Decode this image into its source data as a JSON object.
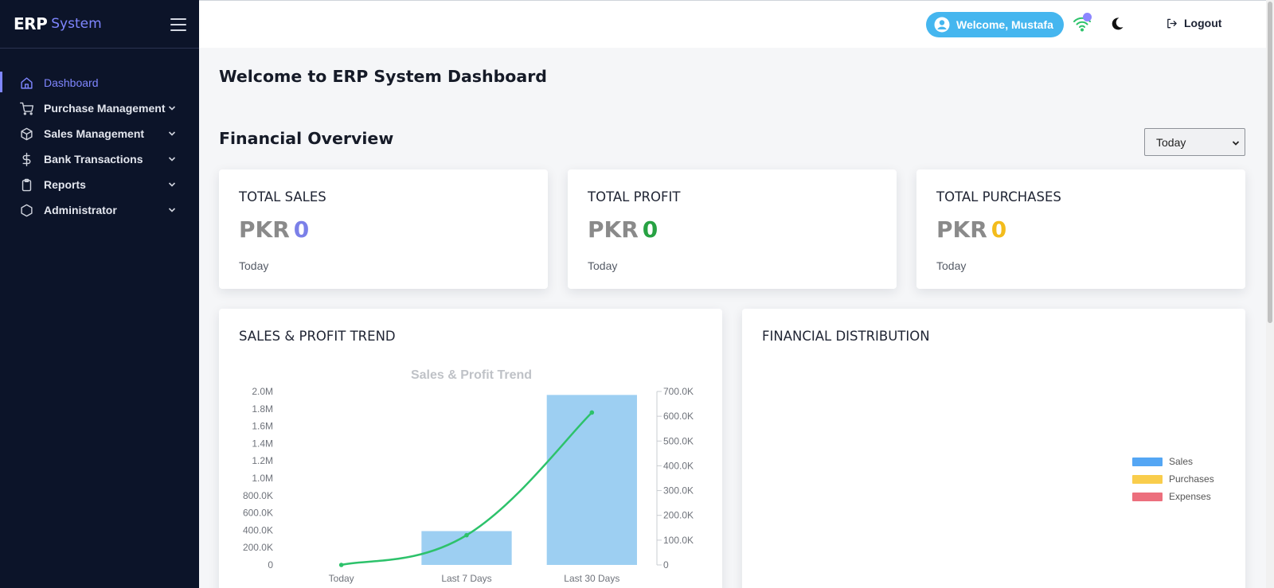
{
  "sidebar": {
    "brand_strong": "ERP",
    "brand_light": "System",
    "items": [
      {
        "label": "Dashboard",
        "icon": "home-icon"
      },
      {
        "label": "Purchase Management",
        "icon": "cart-icon"
      },
      {
        "label": "Sales Management",
        "icon": "box-icon"
      },
      {
        "label": "Bank Transactions",
        "icon": "dollar-icon"
      },
      {
        "label": "Reports",
        "icon": "clipboard-icon"
      },
      {
        "label": "Administrator",
        "icon": "hexagon-icon"
      }
    ]
  },
  "header": {
    "welcome": "Welcome, Mustafa",
    "logout": "Logout"
  },
  "main": {
    "page_title": "Welcome to ERP System Dashboard",
    "section_title": "Financial Overview",
    "period_selected": "Today",
    "cards": [
      {
        "label": "TOTAL SALES",
        "currency": "PKR",
        "value": "0",
        "period": "Today",
        "color": "#7b80e8"
      },
      {
        "label": "TOTAL PROFIT",
        "currency": "PKR",
        "value": "0",
        "period": "Today",
        "color": "#27a243"
      },
      {
        "label": "TOTAL PURCHASES",
        "currency": "PKR",
        "value": "0",
        "period": "Today",
        "color": "#f3bc1c"
      }
    ],
    "trend_title": "SALES & PROFIT TREND",
    "distribution_title": "FINANCIAL DISTRIBUTION"
  },
  "colors": {
    "sidebar_bg": "#0c1429",
    "accent": "#7f86ff",
    "pill": "#45b6ef",
    "bar": "#9dcff2",
    "line": "#2dc26b"
  },
  "chart_data": [
    {
      "type": "bar",
      "title": "Sales & Profit Trend",
      "categories": [
        "Today",
        "Last 7 Days",
        "Last 30 Days"
      ],
      "y_left_ticks": [
        "0",
        "200.0K",
        "400.0K",
        "600.0K",
        "800.0K",
        "1.0M",
        "1.2M",
        "1.4M",
        "1.6M",
        "1.8M",
        "2.0M"
      ],
      "y_right_ticks": [
        "0",
        "100.0K",
        "200.0K",
        "300.0K",
        "400.0K",
        "500.0K",
        "600.0K",
        "700.0K"
      ],
      "ylim_left": [
        0,
        2000000
      ],
      "ylim_right": [
        0,
        700000
      ],
      "series": [
        {
          "type": "bar",
          "axis": "left",
          "values": [
            0,
            390000,
            1960000
          ],
          "color": "#9dcff2"
        },
        {
          "type": "line",
          "axis": "right",
          "values": [
            0,
            120000,
            615000
          ],
          "color": "#2dc26b"
        }
      ]
    },
    {
      "type": "pie",
      "legend": "right",
      "series": [
        {
          "name": "Sales",
          "color": "#54a6f4",
          "value": 0
        },
        {
          "name": "Purchases",
          "color": "#f9cd4c",
          "value": 0
        },
        {
          "name": "Expenses",
          "color": "#ec6f7d",
          "value": 0
        }
      ]
    }
  ]
}
